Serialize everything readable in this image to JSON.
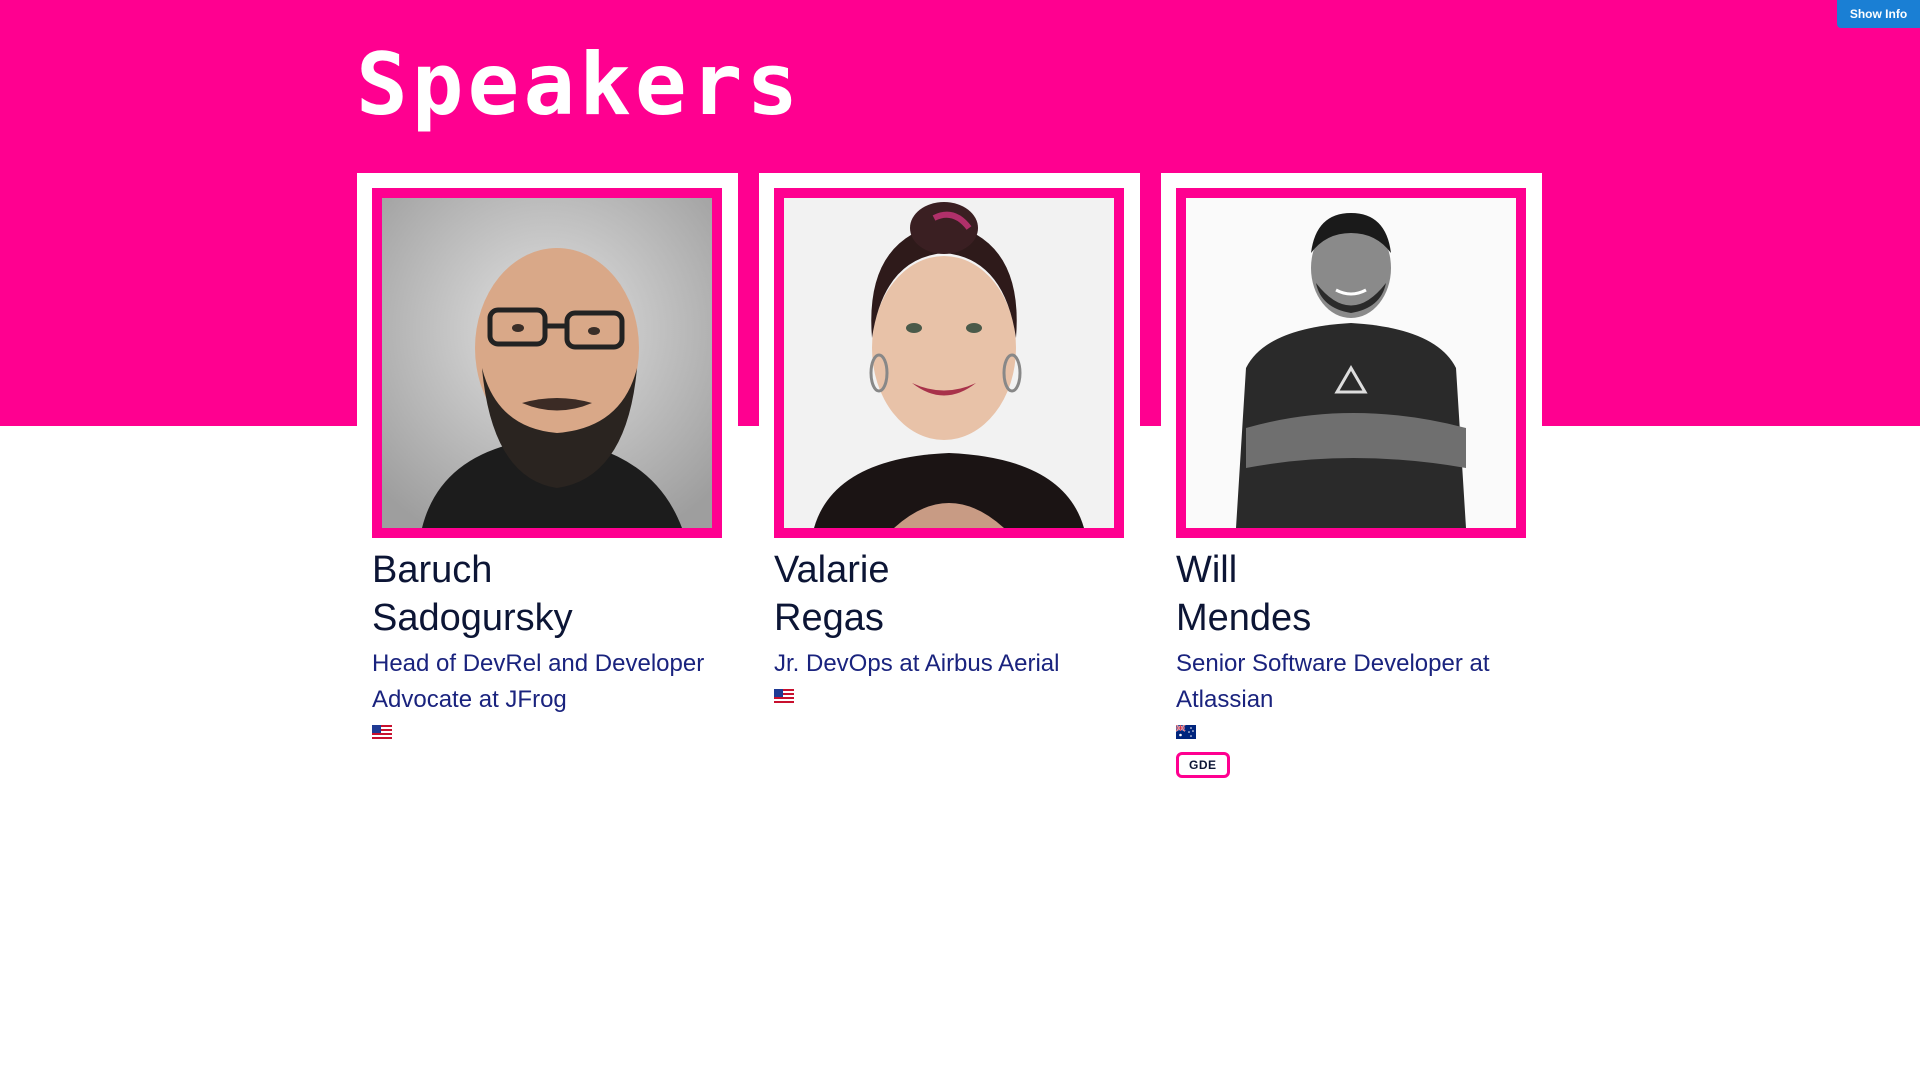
{
  "header": {
    "title": "Speakers",
    "show_info_label": "Show Info"
  },
  "colors": {
    "brand_pink": "#ff0090",
    "button_blue": "#1a7fd4",
    "name_text": "#0c1535",
    "role_text": "#1a237e"
  },
  "speakers": [
    {
      "first_name": "Baruch",
      "last_name": "Sadogursky",
      "role": "Head of DevRel and Developer Advocate at JFrog",
      "flag": "us-flag-icon",
      "badge": null
    },
    {
      "first_name": "Valarie",
      "last_name": "Regas",
      "role": "Jr. DevOps at Airbus Aerial",
      "flag": "us-flag-icon",
      "badge": null
    },
    {
      "first_name": "Will",
      "last_name": "Mendes",
      "role": "Senior Software Developer at Atlassian",
      "flag": "au-flag-icon",
      "badge": "GDE"
    }
  ]
}
